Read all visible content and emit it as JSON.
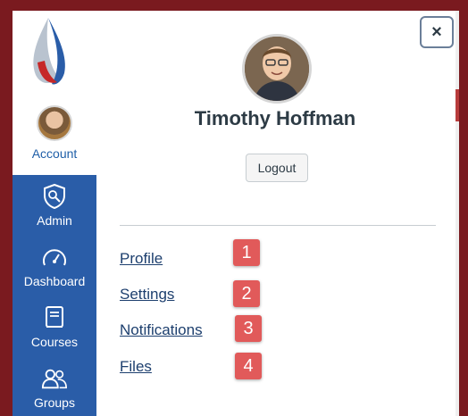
{
  "sidebar": {
    "account_label": "Account",
    "items": [
      {
        "label": "Admin",
        "icon": "admin-shield-icon"
      },
      {
        "label": "Dashboard",
        "icon": "dashboard-gauge-icon"
      },
      {
        "label": "Courses",
        "icon": "courses-book-icon"
      },
      {
        "label": "Groups",
        "icon": "groups-people-icon"
      }
    ]
  },
  "tray": {
    "close_label": "×",
    "user_name": "Timothy Hoffman",
    "logout_label": "Logout",
    "links": [
      {
        "label": "Profile",
        "badge": "1"
      },
      {
        "label": "Settings",
        "badge": "2"
      },
      {
        "label": "Notifications",
        "badge": "3"
      },
      {
        "label": "Files",
        "badge": "4"
      }
    ]
  },
  "colors": {
    "frame": "#7a1a1f",
    "nav_bg": "#2a5da8",
    "link": "#1d3f6e",
    "badge": "#e15a5a"
  }
}
